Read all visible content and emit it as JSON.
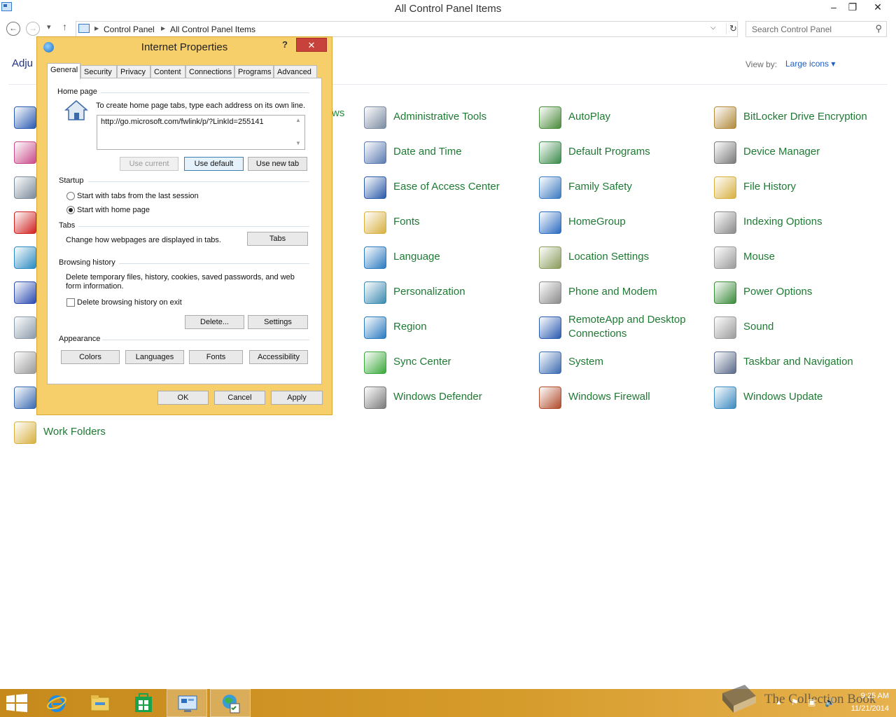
{
  "window": {
    "title": "All Control Panel Items",
    "minimize": "–",
    "maximize": "❐",
    "close": "✕"
  },
  "address": {
    "back": "←",
    "forward": "→",
    "recent": "▾",
    "up": "↑",
    "crumbs": [
      "Control Panel",
      "All Control Panel Items"
    ],
    "separator": "▶",
    "dropdown": "⌵",
    "refresh": "↻"
  },
  "search": {
    "placeholder": "Search Control Panel",
    "icon": "⚲"
  },
  "header": {
    "adjust_partial": "Adju",
    "view_by_label": "View by:",
    "view_by_value": "Large icons ▾",
    "peek_partial": "ws"
  },
  "items": [
    {
      "label": "Administrative Tools",
      "icon": "admin-tools-icon",
      "color": "#7a8aa0"
    },
    {
      "label": "AutoPlay",
      "icon": "autoplay-icon",
      "color": "#4a8a3a"
    },
    {
      "label": "BitLocker Drive Encryption",
      "icon": "bitlocker-icon",
      "color": "#b08a3a"
    },
    {
      "label": "Date and Time",
      "icon": "date-time-icon",
      "color": "#5a7ab0"
    },
    {
      "label": "Default Programs",
      "icon": "default-programs-icon",
      "color": "#3a8a4a"
    },
    {
      "label": "Device Manager",
      "icon": "device-manager-icon",
      "color": "#7a7a7a"
    },
    {
      "label": "Ease of Access Center",
      "icon": "ease-of-access-icon",
      "color": "#2a5aa8"
    },
    {
      "label": "Family Safety",
      "icon": "family-safety-icon",
      "color": "#3a7ac0"
    },
    {
      "label": "File History",
      "icon": "file-history-icon",
      "color": "#d8b040"
    },
    {
      "label": "Fonts",
      "icon": "fonts-icon",
      "color": "#d8b040"
    },
    {
      "label": "HomeGroup",
      "icon": "homegroup-icon",
      "color": "#2a6ac0"
    },
    {
      "label": "Indexing Options",
      "icon": "indexing-options-icon",
      "color": "#8a8a8a"
    },
    {
      "label": "Language",
      "icon": "language-icon",
      "color": "#2a7ac0"
    },
    {
      "label": "Location Settings",
      "icon": "location-settings-icon",
      "color": "#8a9a5a"
    },
    {
      "label": "Mouse",
      "icon": "mouse-icon",
      "color": "#9a9a9a"
    },
    {
      "label": "Personalization",
      "icon": "personalization-icon",
      "color": "#3a8ab0"
    },
    {
      "label": "Phone and Modem",
      "icon": "phone-modem-icon",
      "color": "#8a8a8a"
    },
    {
      "label": "Power Options",
      "icon": "power-options-icon",
      "color": "#3a8a3a"
    },
    {
      "label": "Region",
      "icon": "region-icon",
      "color": "#2a7ac0"
    },
    {
      "label": "RemoteApp and Desktop Connections",
      "icon": "remoteapp-icon",
      "color": "#2a5ab0"
    },
    {
      "label": "Sound",
      "icon": "sound-icon",
      "color": "#9a9a9a"
    },
    {
      "label": "Sync Center",
      "icon": "sync-center-icon",
      "color": "#3aa83a"
    },
    {
      "label": "System",
      "icon": "system-icon",
      "color": "#3a6ab0"
    },
    {
      "label": "Taskbar and Navigation",
      "icon": "taskbar-navigation-icon",
      "color": "#5a6a8a"
    },
    {
      "label": "Windows Defender",
      "icon": "windows-defender-icon",
      "color": "#7a7a7a"
    },
    {
      "label": "Windows Firewall",
      "icon": "windows-firewall-icon",
      "color": "#b04a2a"
    },
    {
      "label": "Windows Update",
      "icon": "windows-update-icon",
      "color": "#3a8ac0"
    },
    {
      "label": "Work Folders",
      "icon": "work-folders-icon",
      "color": "#d8b040"
    }
  ],
  "left_icons": [
    {
      "icon": "action-center-flag-icon",
      "color": "#2a5ab0"
    },
    {
      "icon": "color-management-icon",
      "color": "#c84a8a"
    },
    {
      "icon": "devices-printers-icon",
      "color": "#7a8a9a"
    },
    {
      "icon": "flash-player-icon",
      "color": "#d02020"
    },
    {
      "icon": "internet-options-icon",
      "color": "#2a8ac0"
    },
    {
      "icon": "network-sharing-icon",
      "color": "#2a4ab0"
    },
    {
      "icon": "programs-features-icon",
      "color": "#8a9aaa"
    },
    {
      "icon": "speech-recognition-icon",
      "color": "#9a9a9a"
    },
    {
      "icon": "display-icon",
      "color": "#3a6ab0"
    }
  ],
  "dialog": {
    "title": "Internet Properties",
    "help": "?",
    "close": "✕",
    "tabs": [
      "General",
      "Security",
      "Privacy",
      "Content",
      "Connections",
      "Programs",
      "Advanced"
    ],
    "home_page": {
      "group": "Home page",
      "instruction": "To create home page tabs, type each address on its own line.",
      "url": "http://go.microsoft.com/fwlink/p/?LinkId=255141",
      "use_current": "Use current",
      "use_default": "Use default",
      "use_new_tab": "Use new tab"
    },
    "startup": {
      "group": "Startup",
      "option1": "Start with tabs from the last session",
      "option2": "Start with home page"
    },
    "tabs_group": {
      "group": "Tabs",
      "desc": "Change how webpages are displayed in tabs.",
      "button": "Tabs"
    },
    "browsing": {
      "group": "Browsing history",
      "desc": "Delete temporary files, history, cookies, saved passwords, and web form information.",
      "checkbox": "Delete browsing history on exit",
      "delete": "Delete...",
      "settings": "Settings"
    },
    "appearance": {
      "group": "Appearance",
      "colors": "Colors",
      "languages": "Languages",
      "fonts": "Fonts",
      "accessibility": "Accessibility"
    },
    "ok": "OK",
    "cancel": "Cancel",
    "apply": "Apply"
  },
  "taskbar": {
    "time": "9:25 AM",
    "date": "11/21/2014",
    "watermark": "The Collection Book",
    "tray": [
      "▲",
      "⚑",
      "▣",
      "🔊"
    ]
  }
}
